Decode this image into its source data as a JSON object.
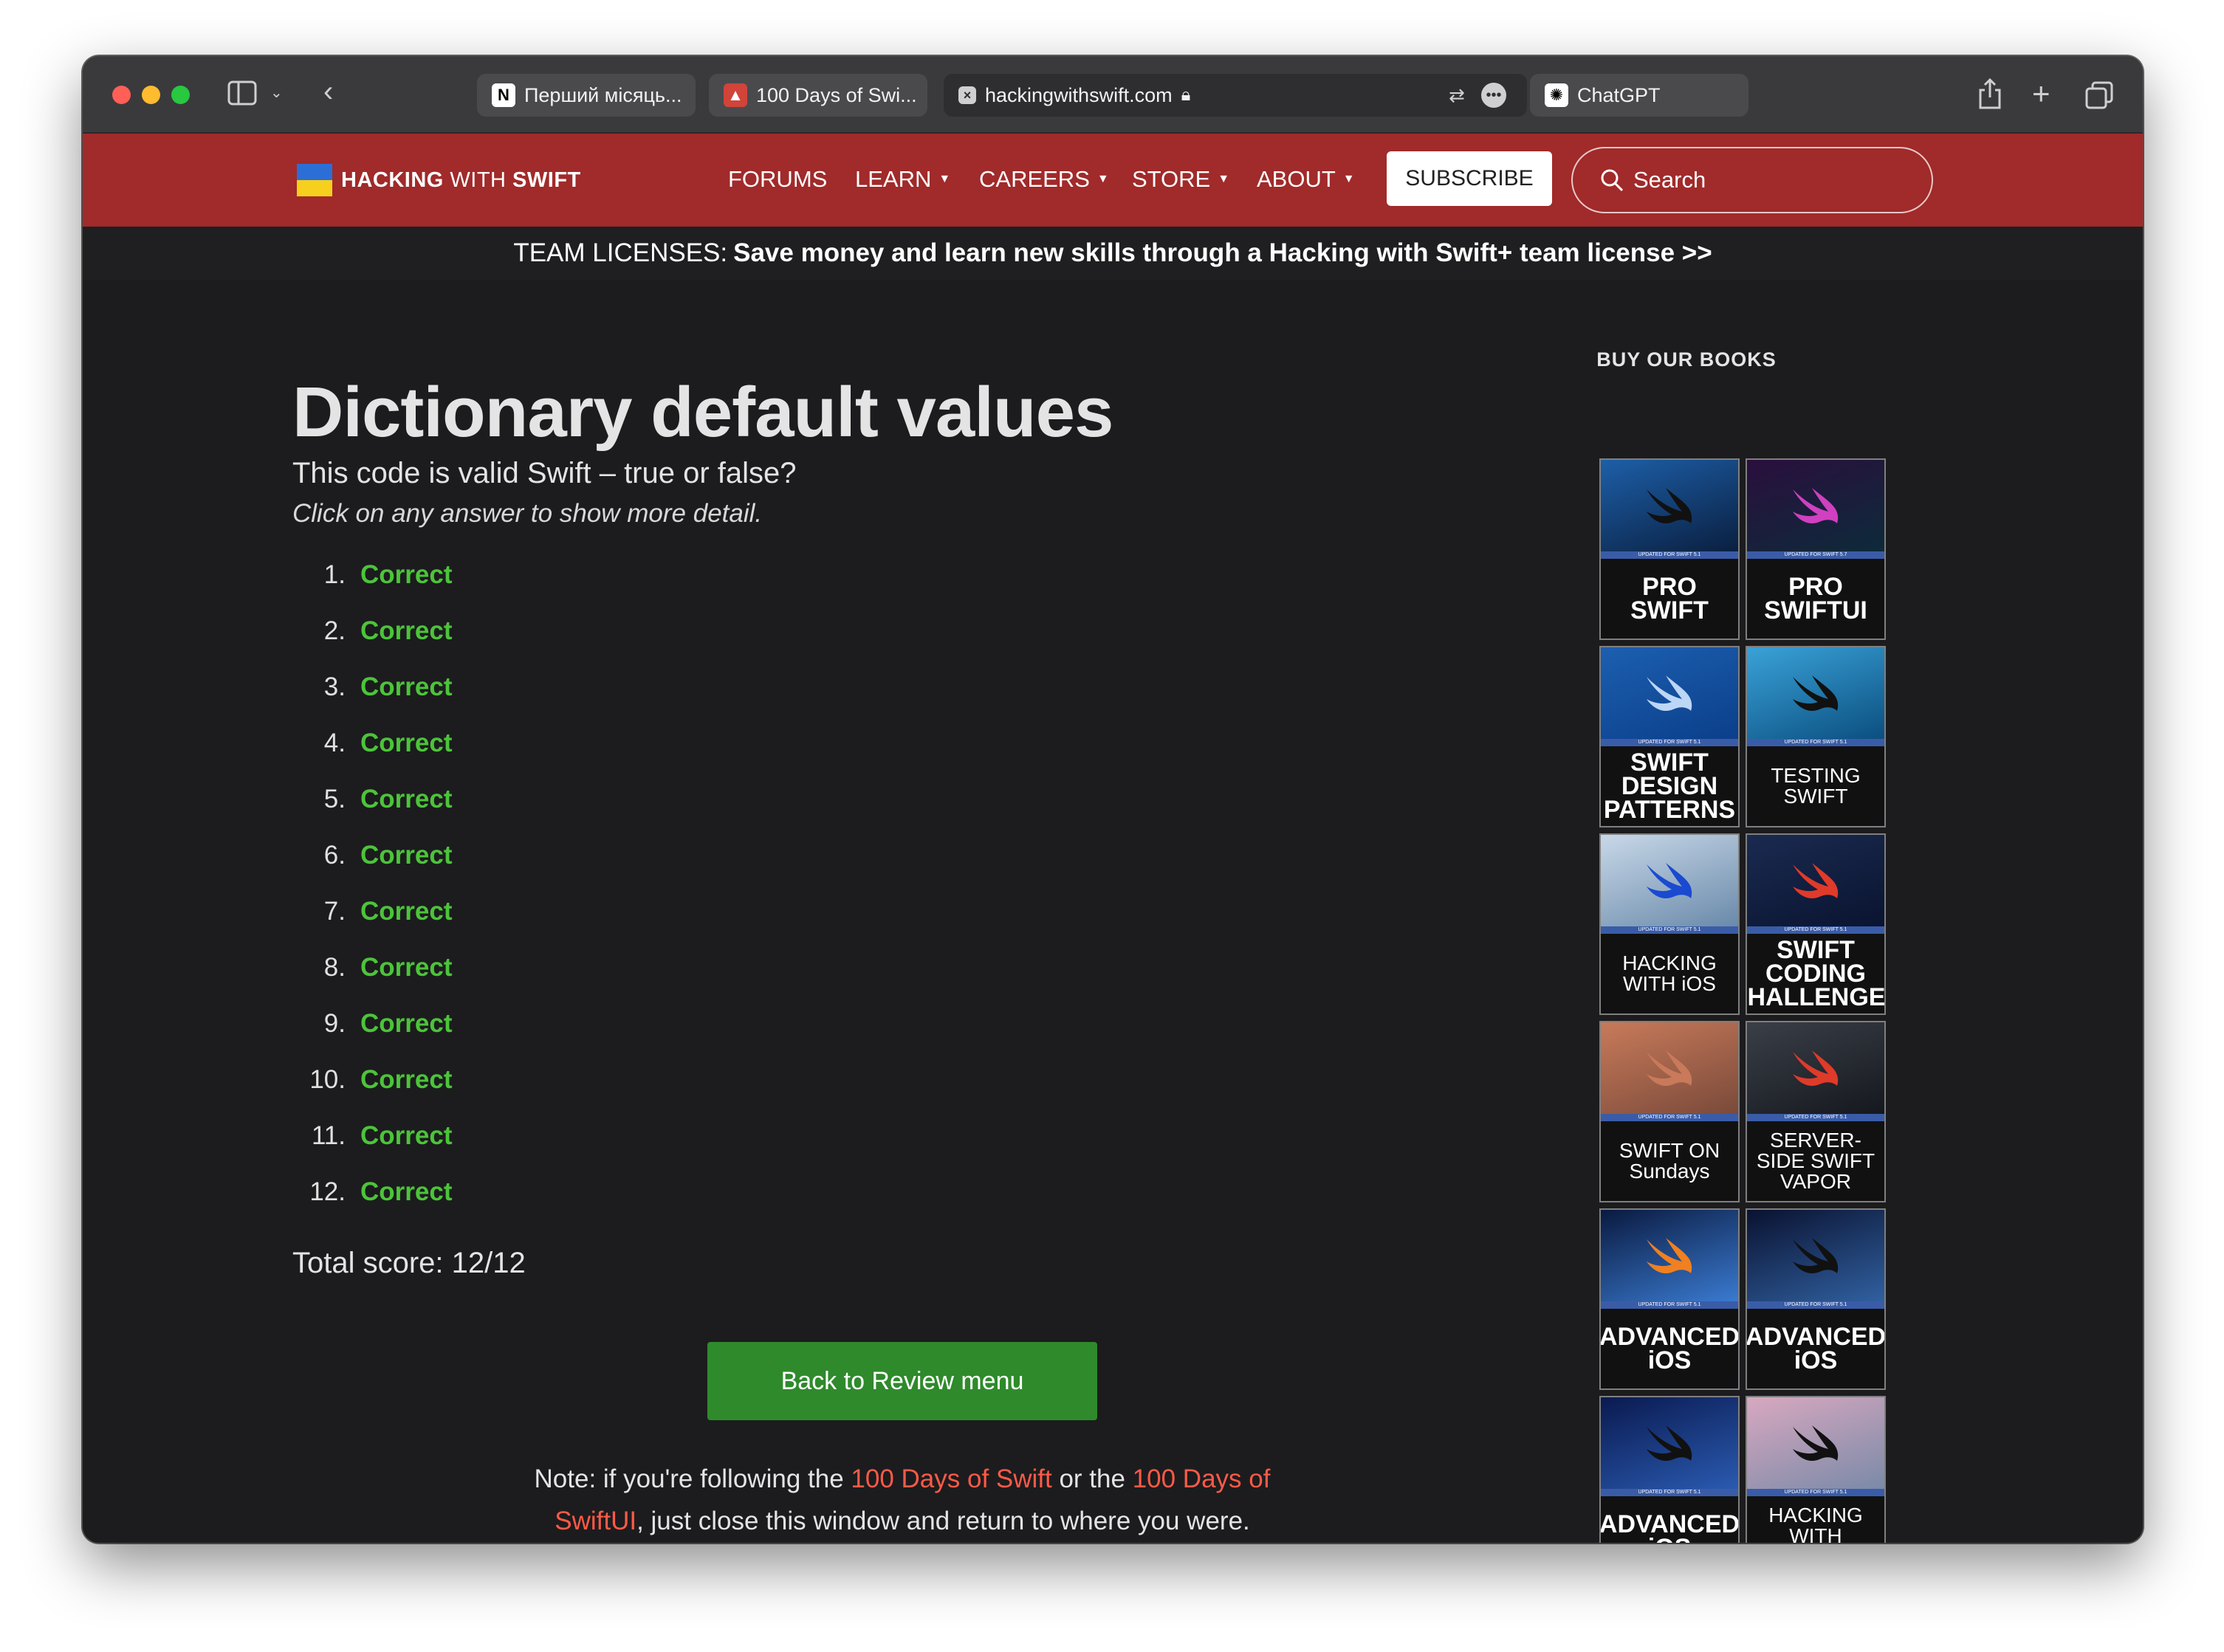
{
  "browser": {
    "tabs": [
      {
        "label": "Перший місяць...",
        "favicon": "notion-icon"
      },
      {
        "label": "100 Days of Swi...",
        "favicon": "hws-icon"
      },
      {
        "label": "hackingwithswift.com",
        "favicon": "close-icon"
      },
      {
        "label": "ChatGPT",
        "favicon": "chatgpt-icon"
      }
    ]
  },
  "header": {
    "logo_bold1": "HACKING",
    "logo_mid": " WITH ",
    "logo_bold2": "SWIFT",
    "nav": [
      {
        "label": "FORUMS",
        "dropdown": false
      },
      {
        "label": "LEARN",
        "dropdown": true
      },
      {
        "label": "CAREERS",
        "dropdown": true
      },
      {
        "label": "STORE",
        "dropdown": true
      },
      {
        "label": "ABOUT",
        "dropdown": true
      }
    ],
    "subscribe_label": "SUBSCRIBE",
    "search_label": "Search"
  },
  "banner": {
    "prefix": "TEAM LICENSES:",
    "text": "Save money and learn new skills through a Hacking with Swift+ team license >>"
  },
  "main": {
    "title": "Dictionary default values",
    "subtitle": "This code is valid Swift – true or false?",
    "hint": "Click on any answer to show more detail.",
    "answers": [
      {
        "num": "1.",
        "result": "Correct"
      },
      {
        "num": "2.",
        "result": "Correct"
      },
      {
        "num": "3.",
        "result": "Correct"
      },
      {
        "num": "4.",
        "result": "Correct"
      },
      {
        "num": "5.",
        "result": "Correct"
      },
      {
        "num": "6.",
        "result": "Correct"
      },
      {
        "num": "7.",
        "result": "Correct"
      },
      {
        "num": "8.",
        "result": "Correct"
      },
      {
        "num": "9.",
        "result": "Correct"
      },
      {
        "num": "10.",
        "result": "Correct"
      },
      {
        "num": "11.",
        "result": "Correct"
      },
      {
        "num": "12.",
        "result": "Correct"
      }
    ],
    "score": "Total score: 12/12",
    "back_button": "Back to Review menu",
    "note_prefix": "Note: if you're following the ",
    "note_link1": "100 Days of Swift",
    "note_mid": " or the ",
    "note_link2": "100 Days of SwiftUI",
    "note_suffix": ", just close this window and return to where you were."
  },
  "sidebar": {
    "title": "BUY OUR BOOKS",
    "books": [
      {
        "label": "PRO SWIFT",
        "strip": "UPDATED FOR SWIFT 5.1",
        "top": "#1d5fa8",
        "bottom": "#0a1f40",
        "bird": "#111111",
        "small": false
      },
      {
        "label": "PRO SWIFTUI",
        "strip": "UPDATED FOR SWIFT 5.7",
        "top": "#2a0f3d",
        "bottom": "#0d2a3a",
        "bird": "#d040c0",
        "small": false
      },
      {
        "label": "SWIFT DESIGN PATTERNS",
        "strip": "UPDATED FOR SWIFT 5.1",
        "top": "#1c5fb0",
        "bottom": "#0b3f8a",
        "bird": "#bcd6f5",
        "small": false
      },
      {
        "label": "TESTING SWIFT",
        "strip": "UPDATED FOR SWIFT 5.1",
        "top": "#3aa2d8",
        "bottom": "#0b4f80",
        "bird": "#111111",
        "small": true
      },
      {
        "label": "HACKING WITH iOS",
        "strip": "UPDATED FOR SWIFT 5.1",
        "top": "#c8d8e8",
        "bottom": "#6a8aaa",
        "bird": "#1a4ad0",
        "small": true
      },
      {
        "label": "SWIFT CODING CHALLENGES",
        "strip": "UPDATED FOR SWIFT 5.1",
        "top": "#1a2a50",
        "bottom": "#0a1430",
        "bird": "#e03a2a",
        "small": false
      },
      {
        "label": "SWIFT ON Sundays",
        "strip": "UPDATED FOR SWIFT 5.1",
        "top": "#c87a5a",
        "bottom": "#7a4a3a",
        "bird": "#c87a5a",
        "small": true
      },
      {
        "label": "SERVER-SIDE SWIFT VAPOR",
        "strip": "UPDATED FOR SWIFT 5.1",
        "top": "#3a3f48",
        "bottom": "#15181e",
        "bird": "#e03a2a",
        "small": true
      },
      {
        "label": "ADVANCED iOS",
        "strip": "UPDATED FOR SWIFT 5.1",
        "top": "#0a1a40",
        "bottom": "#3a7ad0",
        "bird": "#f08020",
        "small": false
      },
      {
        "label": "ADVANCED iOS",
        "strip": "UPDATED FOR SWIFT 5.1",
        "top": "#0a1230",
        "bottom": "#3060a0",
        "bird": "#111111",
        "small": false
      },
      {
        "label": "ADVANCED iOS",
        "strip": "UPDATED FOR SWIFT 5.1",
        "top": "#0a1a50",
        "bottom": "#2a5ab0",
        "bird": "#111111",
        "small": false
      },
      {
        "label": "HACKING WITH watchOS",
        "strip": "UPDATED FOR SWIFT 5.1",
        "top": "#d8a8c0",
        "bottom": "#7a8aa8",
        "bird": "#111111",
        "small": true
      }
    ]
  },
  "colors": {
    "header_red": "#a12a2a",
    "correct_green": "#4cc43a",
    "button_green": "#2f8a2c",
    "link_red": "#ff5a47"
  }
}
